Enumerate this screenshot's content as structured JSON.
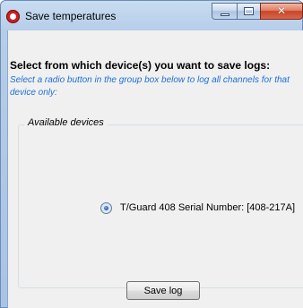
{
  "window": {
    "title": "Save temperatures",
    "close_glyph": "✕",
    "icon": "app-logo-icon"
  },
  "dialog": {
    "heading": "Select from which device(s) you want to save logs:",
    "hint": "Select a radio button in the group box below to log all channels for that device only:",
    "group": {
      "legend": "Available devices",
      "devices": [
        {
          "label": "T/Guard 408 Serial Number: [408-217A]",
          "selected": true
        }
      ]
    },
    "save_label": "Save log"
  },
  "colors": {
    "hint_text": "#1e6fd6",
    "client_bg": "#f0f0f0",
    "frame": "#b6cde9",
    "close_button": "#c9452a"
  }
}
